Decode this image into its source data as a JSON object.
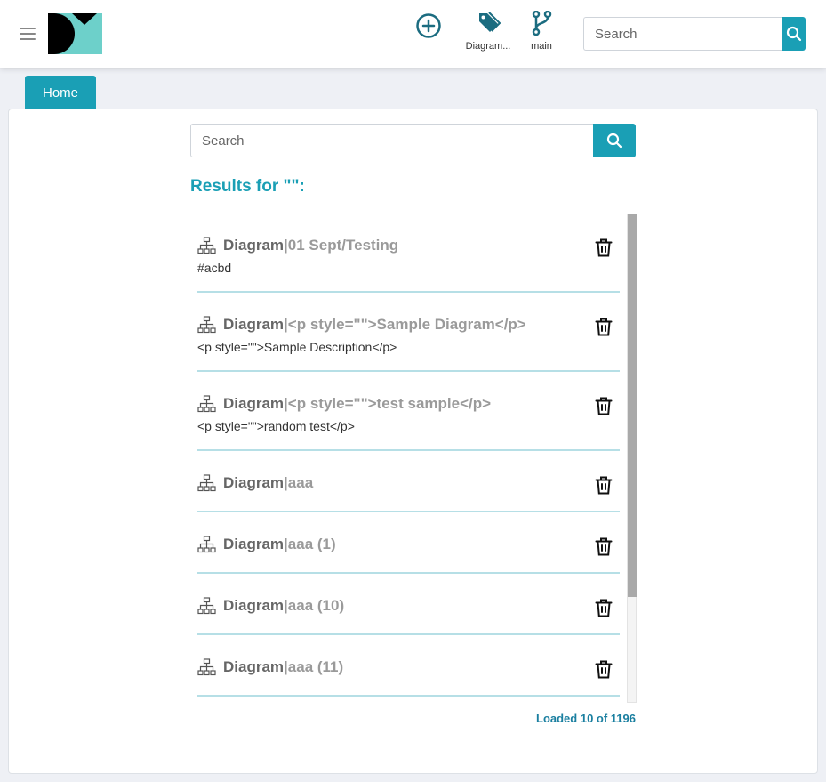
{
  "header": {
    "menu_icon": "hamburger-menu-icon",
    "logo_icon": "app-logo",
    "tools": {
      "add": {
        "icon": "plus-circle-icon"
      },
      "diagram": {
        "icon": "tag-icon",
        "label": "Diagram..."
      },
      "branch": {
        "icon": "git-branch-icon",
        "label": "main"
      }
    },
    "search": {
      "placeholder": "Search",
      "button_icon": "search-icon"
    }
  },
  "tabs": {
    "home_label": "Home"
  },
  "main": {
    "search": {
      "placeholder": "Search",
      "button_icon": "search-icon"
    },
    "results_heading": "Results for \"\":",
    "loaded_text": "Loaded 10 of 1196"
  },
  "results": [
    {
      "type": "Diagram",
      "sep": " | ",
      "name": "01 Sept/Testing",
      "description": "#acbd"
    },
    {
      "type": "Diagram",
      "sep": " | ",
      "name": "<p style=\"\">Sample Diagram</p>",
      "description": "<p style=\"\">Sample Description</p>"
    },
    {
      "type": "Diagram",
      "sep": " | ",
      "name": "<p style=\"\">test sample</p>",
      "description": "<p style=\"\">random test</p>"
    },
    {
      "type": "Diagram",
      "sep": " | ",
      "name": "aaa",
      "description": ""
    },
    {
      "type": "Diagram",
      "sep": " | ",
      "name": "aaa (1)",
      "description": ""
    },
    {
      "type": "Diagram",
      "sep": " | ",
      "name": "aaa (10)",
      "description": ""
    },
    {
      "type": "Diagram",
      "sep": " | ",
      "name": "aaa (11)",
      "description": ""
    }
  ],
  "colors": {
    "accent": "#1a9fb5",
    "logo_teal": "#6dd0ca",
    "icon_teal": "#1b6c80",
    "divider": "#b6dfe6"
  },
  "icons": {
    "result_icon": "hierarchy-icon",
    "delete_icon": "trash-icon"
  }
}
